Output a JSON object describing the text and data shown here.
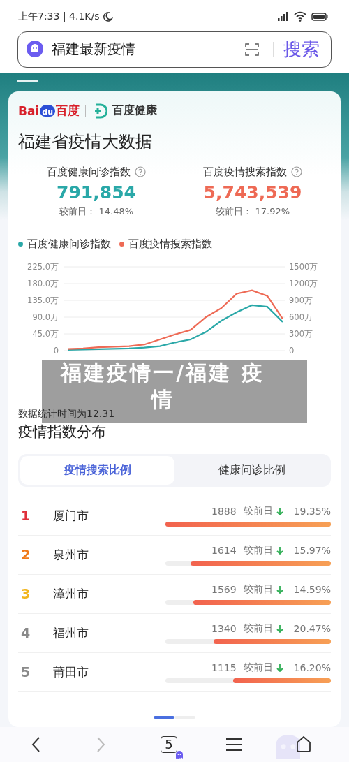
{
  "status_bar": {
    "time": "上午7:33 | 4.1K/s"
  },
  "search": {
    "value": "福建最新疫情",
    "button": "搜索"
  },
  "brand": {
    "baidu_left": "Bai",
    "baidu_mark": "du",
    "baidu_right": "百度",
    "partner": "百度健康"
  },
  "title": "福建省疫情大数据",
  "stats": [
    {
      "label": "百度健康问诊指数",
      "value": "791,854",
      "change": "较前日：-14.48%",
      "color": "#2aa8a8"
    },
    {
      "label": "百度疫情搜索指数",
      "value": "5,743,539",
      "change": "较前日：-17.92%",
      "color": "#ee6a55"
    }
  ],
  "chart_data": {
    "type": "line",
    "ylim": [
      0,
      225
    ],
    "y2lim": [
      0,
      1500
    ],
    "grid": true,
    "yticks": [
      {
        "value": 0,
        "label": "0"
      },
      {
        "value": 45,
        "label": "45.0万"
      },
      {
        "value": 90,
        "label": "90.0万"
      },
      {
        "value": 135,
        "label": "135.0万"
      },
      {
        "value": 180,
        "label": "180.0万"
      },
      {
        "value": 225,
        "label": "225.0万"
      }
    ],
    "y2ticks": [
      {
        "value": 0,
        "label": "0"
      },
      {
        "value": 300,
        "label": "300万"
      },
      {
        "value": 600,
        "label": "600万"
      },
      {
        "value": 900,
        "label": "900万"
      },
      {
        "value": 1200,
        "label": "1200万"
      },
      {
        "value": 1500,
        "label": "1500万"
      }
    ],
    "series": [
      {
        "name": "百度健康问诊指数",
        "color": "#2aa8a8",
        "values": [
          2,
          3,
          4,
          5,
          6,
          8,
          12,
          22,
          30,
          50,
          80,
          103,
          122,
          118,
          77
        ]
      },
      {
        "name": "百度疫情搜索指数",
        "color": "#ee6a55",
        "axis": "y2",
        "values": [
          30,
          40,
          60,
          70,
          80,
          110,
          200,
          290,
          370,
          600,
          760,
          1020,
          1080,
          980,
          570
        ]
      }
    ]
  },
  "chart_note": "数据统计时间为12.31",
  "overlay_caption": "福建疫情一/福建 疫情",
  "section_title": "疫情指数分布",
  "tabs": [
    {
      "label": "疫情搜索比例",
      "selected": true
    },
    {
      "label": "健康问诊比例",
      "selected": false
    }
  ],
  "rows": [
    {
      "rank": "1",
      "color": "#e0303a",
      "city": "厦门市",
      "count": "1888",
      "compare": "较前日",
      "percent": "19.35%",
      "level": 1.0
    },
    {
      "rank": "2",
      "color": "#f07a1a",
      "city": "泉州市",
      "count": "1614",
      "compare": "较前日",
      "percent": "15.97%",
      "level": 0.85
    },
    {
      "rank": "3",
      "color": "#f2b51c",
      "city": "漳州市",
      "count": "1569",
      "compare": "较前日",
      "percent": "14.59%",
      "level": 0.83
    },
    {
      "rank": "4",
      "color": "#8a8a8a",
      "city": "福州市",
      "count": "1340",
      "compare": "较前日",
      "percent": "20.47%",
      "level": 0.71
    },
    {
      "rank": "5",
      "color": "#8a8a8a",
      "city": "莆田市",
      "count": "1115",
      "compare": "较前日",
      "percent": "16.20%",
      "level": 0.59
    }
  ],
  "pager": [
    {
      "selected": true
    },
    {
      "selected": false
    }
  ],
  "nav": {
    "tab_count": "5",
    "forward_disabled": true
  }
}
